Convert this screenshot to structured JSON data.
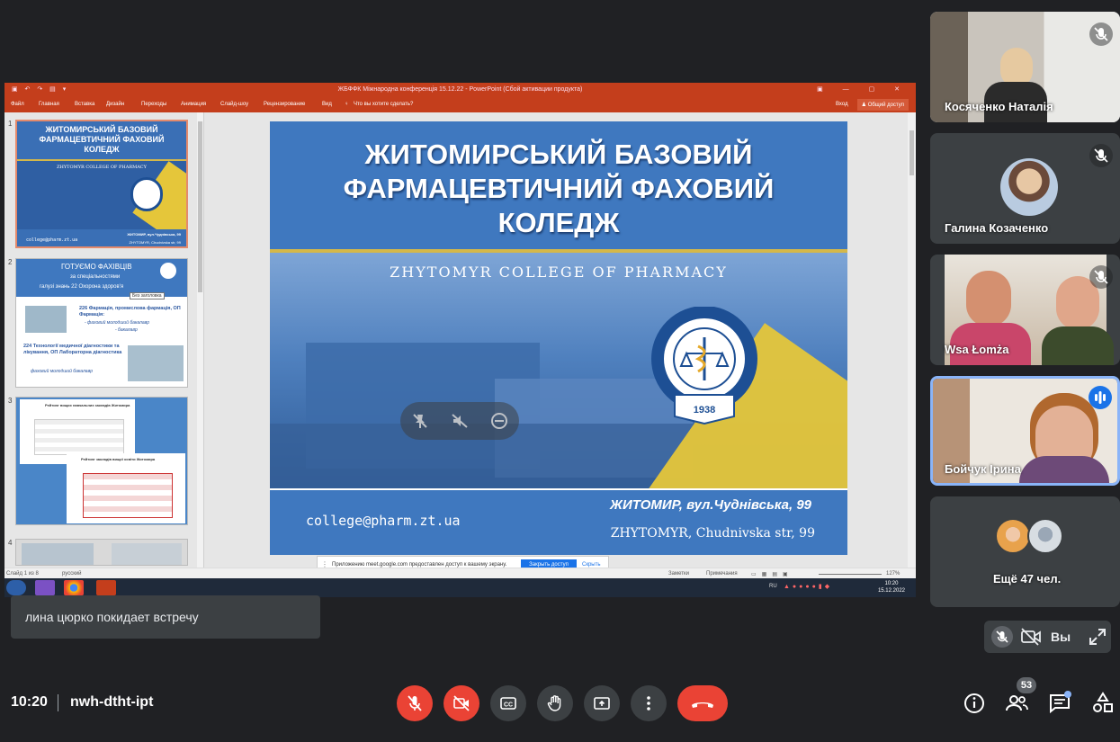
{
  "ppt": {
    "window_title": "ЖБФФК Міжнародна конференція 15.12.22 - PowerPoint (Сбой активации продукта)",
    "ribbon_tabs": [
      "Файл",
      "Главная",
      "Вставка",
      "Дизайн",
      "Переходы",
      "Анимация",
      "Слайд-шоу",
      "Рецензирование",
      "Вид"
    ],
    "tell_me": "Что вы хотите сделать?",
    "sign_in": "Вход",
    "share": "Общий доступ",
    "slide_numbers": [
      "1",
      "2",
      "3",
      "4"
    ],
    "thumb1": {
      "title": "ЖИТОМИРСЬКИЙ БАЗОВИЙ ФАРМАЦЕВТИЧНИЙ ФАХОВИЙ КОЛЕДЖ",
      "subtitle": "ZHYTOMYR COLLEGE OF PHARMACY",
      "email": "college@pharm.zt.ua",
      "addr1": "ЖИТОМИР, вул.Чуднівська, 99",
      "addr2": "ZHYTOMYR, Chudnivska str, 99"
    },
    "thumb2": {
      "title": "ГОТУЄМО ФАХІВЦІВ",
      "line1": "за спеціальностями",
      "line2": "галузі знань 22 Охорона здоров'я",
      "tooltip": "Без заголовка",
      "item1": "226 Фармація, промислова фармація, ОП Фармація:",
      "item1_sub1": "- фаховий молодший бакалавр",
      "item1_sub2": "- бакалавр",
      "item2": "224 Технології медичної діагностики та лікування, ОП Лабораторна діагностика",
      "item2_sub": "фаховий молодший бакалавр"
    },
    "thumb3": {
      "t1": "Рейтинг вищих навчальних закладів Житомира",
      "t2": "Рейтинг закладів вищої освіти Житомира"
    },
    "status_slide": "Слайд 1 из 8",
    "status_lang": "русский",
    "status_notes": "Заметки",
    "status_comments": "Примечания",
    "status_zoom": "127%",
    "tray_lang": "RU",
    "tray_time": "10:20",
    "tray_date": "15.12.2022"
  },
  "slide": {
    "title_line1": "ЖИТОМИРСЬКИЙ БАЗОВИЙ",
    "title_line2": "ФАРМАЦЕВТИЧНИЙ ФАХОВИЙ",
    "title_line3": "КОЛЕДЖ",
    "subtitle": "ZHYTOMYR COLLEGE OF PHARMACY",
    "seal_text": "ЖИТОМИРСЬКИЙ БАЗОВИЙ ФАРМАЦЕВТИЧНИЙ КОЛЕДЖ",
    "seal_year": "1938",
    "email": "college@pharm.zt.ua",
    "addr1": "ЖИТОМИР, вул.Чуднівська, 99",
    "addr2": "ZHYTOMYR, Chudnivska str, 99"
  },
  "share_bar": {
    "message": "Приложению meet.google.com предоставлен доступ к вашему экрану.",
    "stop": "Закрыть доступ",
    "hide": "Скрыть"
  },
  "participants": [
    {
      "name": "Косяченко Наталія",
      "muted": true
    },
    {
      "name": "Галина Козаченко",
      "muted": true
    },
    {
      "name": "Wsa Łomża",
      "muted": true
    },
    {
      "name": "Бойчук Ірина",
      "speaking": true
    },
    {
      "name": "Ещё 47 чел."
    }
  ],
  "toast": "лина цюрко покидает встречу",
  "self": {
    "label": "Вы"
  },
  "meeting": {
    "time": "10:20",
    "code": "nwh-dtht-ipt",
    "people_count": "53"
  },
  "colors": {
    "end_call": "#ea4335",
    "ppt_accent": "#c43e1c",
    "slide_blue": "#3f78bf",
    "speaking": "#1a73e8"
  }
}
